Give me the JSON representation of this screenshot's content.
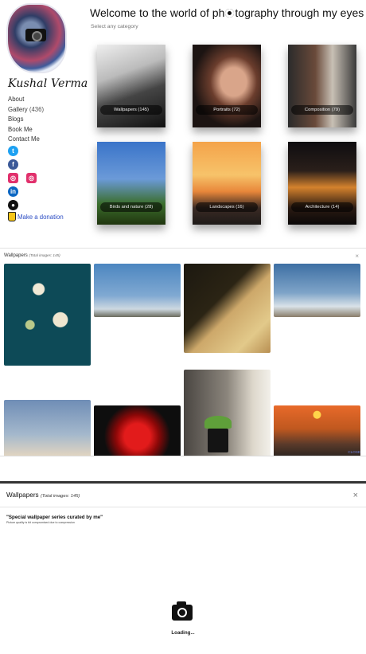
{
  "home": {
    "signature": "Kushal Verma",
    "title_before": "Welcome to the world of ph",
    "title_after": "tography through my eyes",
    "subtitle": "Select any category",
    "nav": {
      "about": "About",
      "gallery": "Gallery",
      "gallery_count": "(436)",
      "blogs": "Blogs",
      "book_me": "Book Me",
      "contact_me": "Contact Me"
    },
    "socials": {
      "twitter": "twitter-icon",
      "facebook": "facebook-icon",
      "instagram": "instagram-icon",
      "linkedin": "linkedin-icon",
      "github": "github-icon"
    },
    "donation": "Make a donation",
    "categories": [
      {
        "label": "Wallpapers (145)"
      },
      {
        "label": "Portraits (72)"
      },
      {
        "label": "Composition (79)"
      },
      {
        "label": "Birds and nature (28)"
      },
      {
        "label": "Landscapes (16)"
      },
      {
        "label": "Architecture (14)"
      }
    ]
  },
  "gallery": {
    "title": "Wallpapers",
    "total": "(Total images: 145)",
    "close_x": "×",
    "close_button": "CLOSE"
  },
  "loading": {
    "title": "Wallpapers",
    "total": "(Total images: 145)",
    "close_x": "×",
    "quote": "\"Special wallpaper series curated by me\"",
    "note": "Picture quality is bit compromised due to compression",
    "loading_text": "Loading..."
  }
}
